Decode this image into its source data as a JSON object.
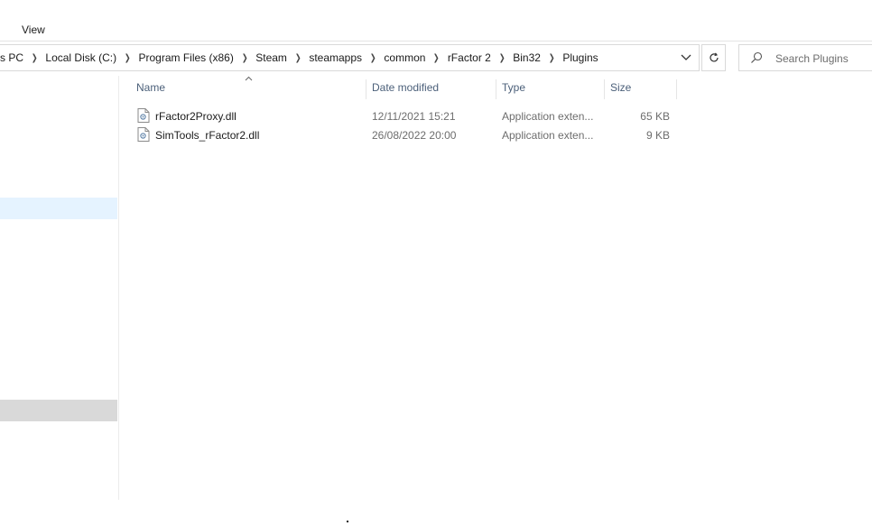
{
  "ribbon": {
    "view_tab": "View"
  },
  "address": {
    "crumbs": [
      "s PC",
      "Local Disk (C:)",
      "Program Files (x86)",
      "Steam",
      "steamapps",
      "common",
      "rFactor 2",
      "Bin32",
      "Plugins"
    ]
  },
  "search": {
    "placeholder": "Search Plugins"
  },
  "columns": {
    "name": "Name",
    "date": "Date modified",
    "type": "Type",
    "size": "Size"
  },
  "files": [
    {
      "name": "rFactor2Proxy.dll",
      "date": "12/11/2021 15:21",
      "type": "Application exten...",
      "size": "65 KB",
      "icon": "dll-file-icon"
    },
    {
      "name": "SimTools_rFactor2.dll",
      "date": "26/08/2022 20:00",
      "type": "Application exten...",
      "size": "9 KB",
      "icon": "dll-file-icon"
    }
  ],
  "colors": {
    "selected_nav": "#e5f3ff",
    "header_text": "#4c607a",
    "secondary_text": "#6d6d6d"
  }
}
